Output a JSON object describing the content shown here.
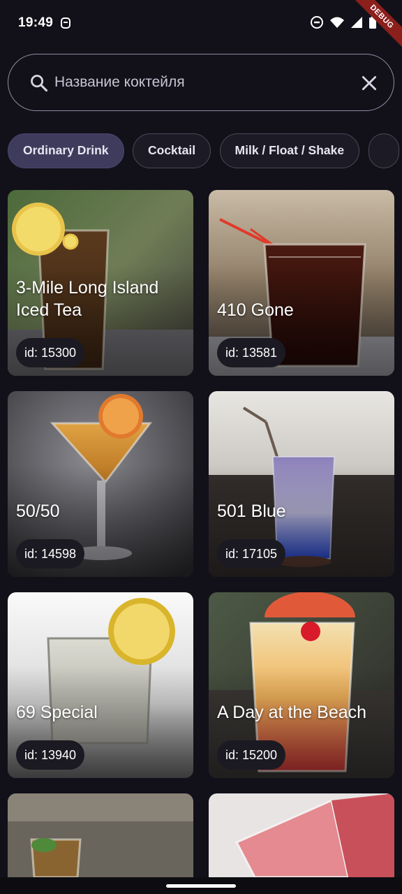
{
  "status": {
    "time": "19:49",
    "debug_label": "DEBUG"
  },
  "search": {
    "placeholder": "Название коктейля",
    "value": "",
    "icon": "search-icon",
    "clear_icon": "close-icon"
  },
  "categories": [
    {
      "label": "Ordinary Drink",
      "selected": true
    },
    {
      "label": "Cocktail",
      "selected": false
    },
    {
      "label": "Milk / Float / Shake",
      "selected": false
    }
  ],
  "drinks": [
    {
      "title": "3-Mile Long Island Iced Tea",
      "id": "id: 15300"
    },
    {
      "title": "410 Gone",
      "id": "id: 13581"
    },
    {
      "title": "50/50",
      "id": "id: 14598"
    },
    {
      "title": "501 Blue",
      "id": "id: 17105"
    },
    {
      "title": "69 Special",
      "id": "id: 13940"
    },
    {
      "title": "A Day at the Beach",
      "id": "id: 15200"
    }
  ],
  "colors": {
    "background": "#12111a",
    "chip_selected": "#3e3b5c",
    "chip": "#1c1b25",
    "id_badge": "#1b1a22",
    "debug_ribbon": "#8b1f1c"
  }
}
